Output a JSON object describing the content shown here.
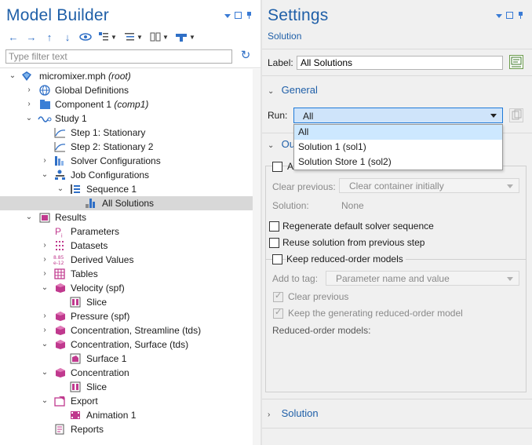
{
  "model_builder": {
    "title": "Model Builder",
    "filter_placeholder": "Type filter text",
    "tree": [
      {
        "label": "micromixer.mph",
        "suffix": "(root)"
      },
      {
        "label": "Global Definitions"
      },
      {
        "label": "Component 1",
        "suffix": "(comp1)"
      },
      {
        "label": "Study 1"
      },
      {
        "label": "Step 1: Stationary"
      },
      {
        "label": "Step 2: Stationary 2"
      },
      {
        "label": "Solver Configurations"
      },
      {
        "label": "Job Configurations"
      },
      {
        "label": "Sequence 1"
      },
      {
        "label": "All Solutions"
      },
      {
        "label": "Results"
      },
      {
        "label": "Parameters"
      },
      {
        "label": "Datasets"
      },
      {
        "label": "Derived Values"
      },
      {
        "label": "Tables"
      },
      {
        "label": "Velocity (spf)"
      },
      {
        "label": "Slice"
      },
      {
        "label": "Pressure (spf)"
      },
      {
        "label": "Concentration, Streamline (tds)"
      },
      {
        "label": "Concentration, Surface (tds)"
      },
      {
        "label": "Surface 1"
      },
      {
        "label": "Concentration"
      },
      {
        "label": "Slice"
      },
      {
        "label": "Export"
      },
      {
        "label": "Animation 1"
      },
      {
        "label": "Reports"
      }
    ]
  },
  "settings": {
    "title": "Settings",
    "subtitle": "Solution",
    "label_caption": "Label:",
    "label_value": "All Solutions",
    "general_section": "General",
    "run_caption": "Run:",
    "run_value": "All",
    "run_options": [
      "All",
      "Solution 1 (sol1)",
      "Solution Store 1 (sol2)"
    ],
    "output_section_partial": "Ou",
    "group1_partial": "A",
    "clear_previous_caption": "Clear previous:",
    "clear_previous_value": "Clear container initially",
    "solution_caption": "Solution:",
    "solution_value": "None",
    "regenerate_label": "Regenerate default solver sequence",
    "reuse_label": "Reuse solution from previous step",
    "keep_rom_label": "Keep reduced-order models",
    "add_to_tag_caption": "Add to tag:",
    "add_to_tag_value": "Parameter name and value",
    "clear_previous_check": "Clear previous",
    "keep_generating_check": "Keep the generating reduced-order model",
    "reduced_models_caption": "Reduced-order models:",
    "solution_section": "Solution"
  },
  "colors": {
    "accent_blue": "#1f5fa8",
    "selection": "#d8d8d8",
    "combo_active": "#cfe4fa"
  }
}
